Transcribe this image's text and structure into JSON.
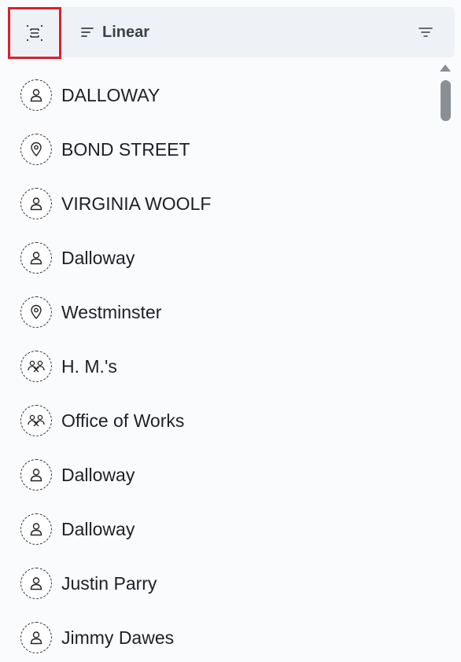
{
  "toolbar": {
    "focus_icon": "focus-frame-icon",
    "sort_icon": "sort-lines-icon",
    "sort_label": "Linear",
    "filter_icon": "filter-lines-icon",
    "highlight_color": "#d9212c"
  },
  "items": [
    {
      "label": "DALLOWAY",
      "kind": "person",
      "icon": "person-icon"
    },
    {
      "label": "BOND STREET",
      "kind": "place",
      "icon": "location-pin-icon"
    },
    {
      "label": "VIRGINIA WOOLF",
      "kind": "person",
      "icon": "person-icon"
    },
    {
      "label": "Dalloway",
      "kind": "person",
      "icon": "person-icon"
    },
    {
      "label": "Westminster",
      "kind": "place",
      "icon": "location-pin-icon"
    },
    {
      "label": "H. M.'s",
      "kind": "group",
      "icon": "group-icon"
    },
    {
      "label": "Office of Works",
      "kind": "group",
      "icon": "group-icon"
    },
    {
      "label": "Dalloway",
      "kind": "person",
      "icon": "person-icon"
    },
    {
      "label": "Dalloway",
      "kind": "person",
      "icon": "person-icon"
    },
    {
      "label": "Justin Parry",
      "kind": "person",
      "icon": "person-icon"
    },
    {
      "label": "Jimmy Dawes",
      "kind": "person",
      "icon": "person-icon"
    }
  ]
}
